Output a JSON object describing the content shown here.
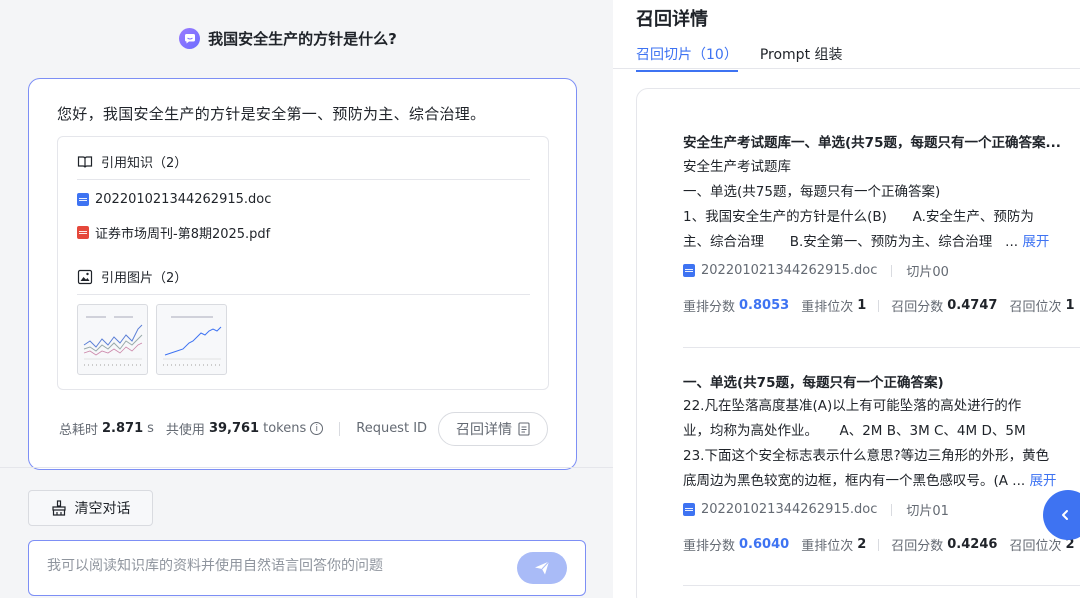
{
  "chat": {
    "question": "我国安全生产的方针是什么?",
    "answer": "您好，我国安全生产的方针是安全第一、预防为主、综合治理。",
    "knowledge_heading": "引用知识（2）",
    "files": [
      {
        "name": "202201021344262915.doc",
        "type": "doc"
      },
      {
        "name": "证券市场周刊-第8期2025.pdf",
        "type": "pdf"
      }
    ],
    "images_heading": "引用图片（2）",
    "stats": {
      "time_label": "总耗时",
      "time_value": "2.871",
      "time_unit": "s",
      "tokens_label": "共使用",
      "tokens_value": "39,761",
      "tokens_unit": "tokens",
      "request_id_label": "Request ID"
    },
    "recall_button": "召回详情",
    "clear_button": "清空对话",
    "input_placeholder": "我可以阅读知识库的资料并使用自然语言回答你的问题"
  },
  "recall": {
    "title": "召回详情",
    "tabs": [
      {
        "label": "召回切片（10）",
        "active": true
      },
      {
        "label": "Prompt 组装",
        "active": false
      }
    ],
    "chunks": [
      {
        "title": "安全生产考试题库一、单选(共75题，每题只有一个正确答案...",
        "lines": [
          "安全生产考试题库",
          "一、单选(共75题，每题只有一个正确答案)",
          "1、我国安全生产的方针是什么(B)      A.安全生产、预防为",
          "主、综合治理      B.安全第一、预防为主、综合治理   ... "
        ],
        "expand": "展开",
        "file": "202201021344262915.doc",
        "slice": "切片00",
        "rerank_score_label": "重排分数",
        "rerank_score": "0.8053",
        "rerank_rank_label": "重排位次",
        "rerank_rank": "1",
        "recall_score_label": "召回分数",
        "recall_score": "0.4747",
        "recall_rank_label": "召回位次",
        "recall_rank": "1"
      },
      {
        "title": "一、单选(共75题，每题只有一个正确答案)",
        "lines": [
          "22.凡在坠落高度基准(A)以上有可能坠落的高处进行的作",
          "业，均称为高处作业。     A、2M B、3M C、4M D、5M",
          "23.下面这个安全标志表示什么意思?等边三角形的外形，黄色",
          "底周边为黑色较宽的边框，框内有一个黑色感叹号。(A ... "
        ],
        "expand": "展开",
        "file": "202201021344262915.doc",
        "slice": "切片01",
        "rerank_score_label": "重排分数",
        "rerank_score": "0.6040",
        "rerank_rank_label": "重排位次",
        "rerank_rank": "2",
        "recall_score_label": "召回分数",
        "recall_score": "0.4246",
        "recall_rank_label": "召回位次",
        "recall_rank": "2"
      }
    ]
  },
  "colors": {
    "accent": "#3e73f2",
    "border_accent": "#7d8ff5",
    "send_button": "#a9bbf7",
    "left_bg": "#f4f5f7"
  }
}
